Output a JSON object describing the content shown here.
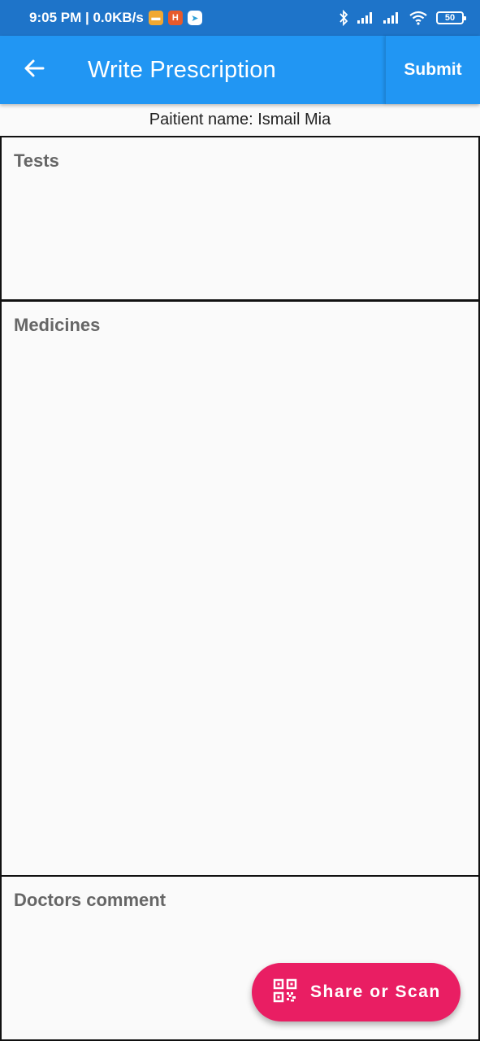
{
  "status_bar": {
    "time_speed": "9:05 PM | 0.0KB/s",
    "battery": "50",
    "icons": [
      "message-notification-icon",
      "h-app-notification-icon",
      "telegram-notification-icon",
      "bluetooth-icon",
      "signal-icon",
      "signal-icon",
      "wifi-icon",
      "battery-icon"
    ]
  },
  "app_bar": {
    "title": "Write Prescription",
    "submit_label": "Submit",
    "back_icon": "arrow-left-icon",
    "background": "#2196f3"
  },
  "patient": {
    "label": "Paitient name: Ismail Mia"
  },
  "sections": {
    "tests_label": "Tests",
    "medicines_label": "Medicines",
    "comment_label": "Doctors comment"
  },
  "fab": {
    "label": "Share or Scan",
    "icon": "qr-code-icon",
    "background": "#e91e63"
  }
}
